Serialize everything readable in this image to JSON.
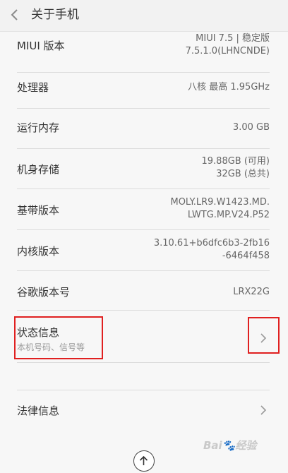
{
  "header": {
    "title": "关于手机"
  },
  "rows": [
    {
      "label": "MIUI 版本",
      "value_line1": "MIUI 7.5 | 稳定版",
      "value_line2": "7.5.1.0(LHNCNDE)"
    },
    {
      "label": "处理器",
      "value": "八核 最高 1.95GHz"
    },
    {
      "label": "运行内存",
      "value": "3.00 GB"
    },
    {
      "label": "机身存储",
      "value_line1": "19.88GB (可用)",
      "value_line2": "32GB (总共)"
    },
    {
      "label": "基带版本",
      "value_line1": "MOLY.LR9.W1423.MD.",
      "value_line2": "LWTG.MP.V24.P52"
    },
    {
      "label": "内核版本",
      "value_line1": "3.10.61+b6dfc6b3-2fb16",
      "value_line2": "-6464f458"
    },
    {
      "label": "谷歌版本号",
      "value": "LRX22G"
    }
  ],
  "status_info": {
    "label": "状态信息",
    "subtitle": "本机号码、信号等"
  },
  "legal": {
    "label": "法律信息"
  },
  "watermark": {
    "text": "Bai",
    "text2": "经验"
  },
  "colors": {
    "highlight": "#e02020",
    "background": "#f7f7f7"
  }
}
